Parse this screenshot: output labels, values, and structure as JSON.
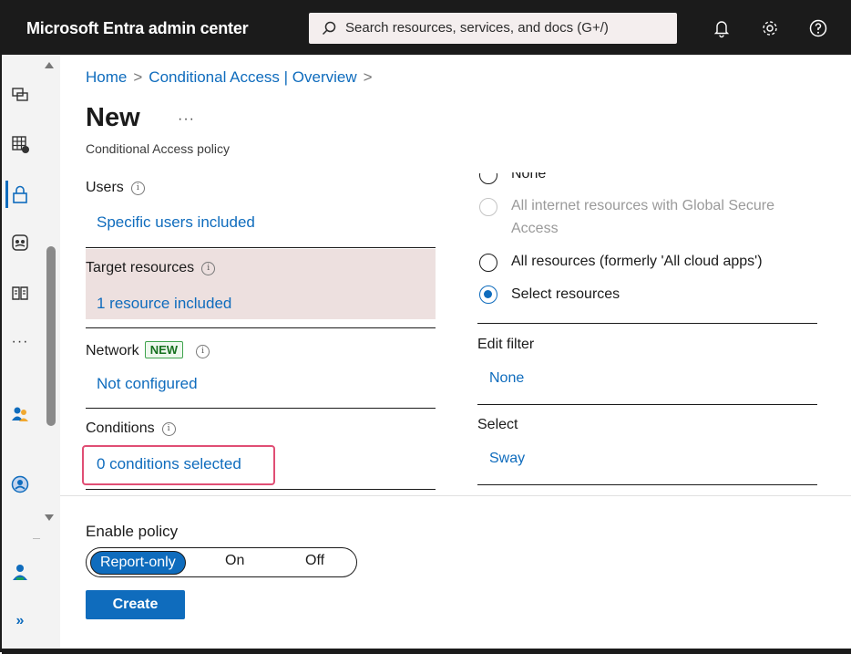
{
  "app": {
    "title": "Microsoft Entra admin center"
  },
  "search": {
    "placeholder": "Search resources, services, and docs (G+/)"
  },
  "topbar": {
    "icons": [
      "bell-icon",
      "gear-icon",
      "help-icon"
    ]
  },
  "rail": {
    "icons": [
      "home-icon",
      "grid-icon",
      "lock-icon",
      "identity-icon",
      "book-icon",
      "more-icon",
      "users-icon",
      "protection-icon",
      "admin-icon",
      "expand-icon"
    ],
    "more_label": "···",
    "expand_label": "»"
  },
  "breadcrumb": {
    "home": "Home",
    "sep": ">",
    "overview": "Conditional Access | Overview"
  },
  "page": {
    "title": "New",
    "more": "···",
    "subtitle": "Conditional Access policy"
  },
  "sections": {
    "users": {
      "label": "Users",
      "value": "Specific users included"
    },
    "target": {
      "label": "Target resources",
      "value": "1 resource included"
    },
    "network": {
      "label": "Network",
      "badge": "NEW",
      "value": "Not configured"
    },
    "conditions": {
      "label": "Conditions",
      "value": "0 conditions selected"
    }
  },
  "info_glyph": "i",
  "resources": {
    "options": [
      {
        "label": "None",
        "state": "unchecked"
      },
      {
        "label": "All internet resources with Global Secure",
        "label_line2": "Access",
        "state": "disabled"
      },
      {
        "label": "All resources (formerly 'All cloud apps')",
        "state": "unchecked"
      },
      {
        "label": "Select resources",
        "state": "checked"
      }
    ],
    "edit_filter": {
      "label": "Edit filter",
      "value": "None"
    },
    "select": {
      "label": "Select",
      "value": "Sway"
    }
  },
  "enable_policy": {
    "label": "Enable policy",
    "options": [
      "Report-only",
      "On",
      "Off"
    ],
    "selected": "Report-only"
  },
  "create_button": "Create",
  "colors": {
    "accent": "#0f6cbd",
    "topbar": "#1b1b1b",
    "highlight": "#e04e74",
    "target_bg": "#ede0df"
  }
}
